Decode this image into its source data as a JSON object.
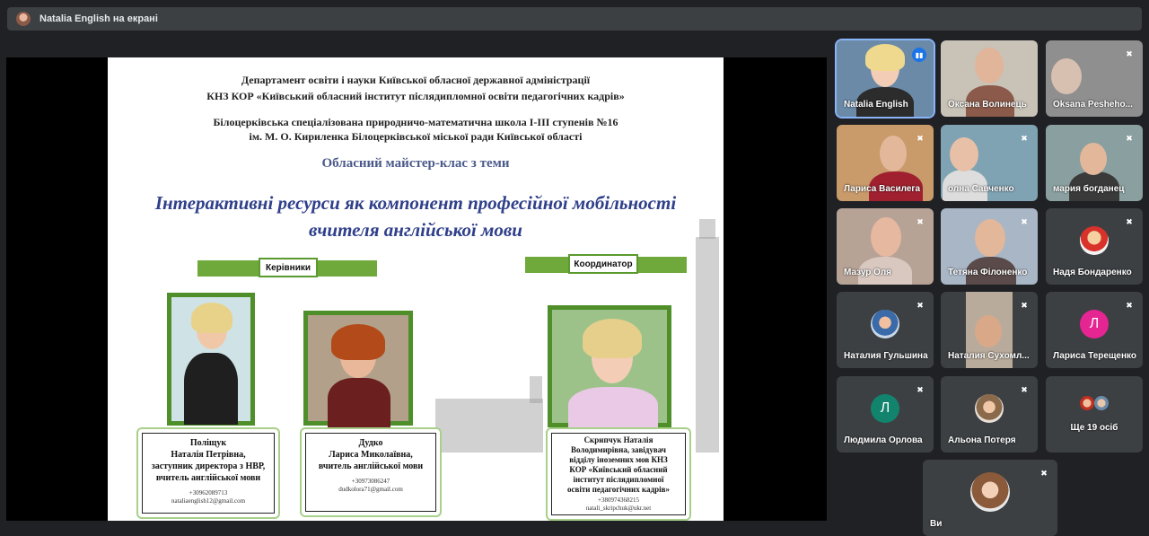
{
  "presenter": {
    "text": "Natalia English на екрані"
  },
  "slide": {
    "header1": "Департамент освіти і науки Київської обласної державної адміністрації",
    "header2": "КНЗ КОР «Київський обласний інститут післядипломної освіти педагогічних кадрів»",
    "header3": "Білоцерківська спеціалізована природничо-математична школа I-III ступенів №16",
    "header4": "ім. М. О. Кириленка Білоцерківської міської ради Київської області",
    "subtitle": "Обласний майстер-клас з теми",
    "topic1": "Інтерактивні ресурси як компонент професійної мобільності",
    "topic2": "вчителя англійської мови",
    "ribbon_left": "Керівники",
    "ribbon_right": "Координатор",
    "cards": [
      {
        "name": "Поліщук\nНаталія Петрівна,\nзаступник директора з НВР,\nвчитель англійської мови",
        "contact": "+30962089713\nnataliaenglish12@gmail.com"
      },
      {
        "name": "Дудко\nЛариса Миколаївна,\nвчитель англійської мови",
        "contact": "+30973086247\ndudkolora71@gmail.com"
      },
      {
        "name": "Скрипчук Наталія\nВолодимирівна, завідувач\nвідділу іноземних мов КНЗ\nКОР «Київський обласний\nінститут післядипломної\nосвіти педагогічних кадрів»",
        "contact": "+380974368215\nnatali_skripchuk@ukr.net"
      }
    ]
  },
  "participants": [
    {
      "name": "Natalia English",
      "mic": "speaking"
    },
    {
      "name": "Оксана Волинець",
      "mic": "none"
    },
    {
      "name": "Oksana Pesheho...",
      "mic": "muted"
    },
    {
      "name": "Лариса Василега",
      "mic": "muted"
    },
    {
      "name": "олна Савченко",
      "mic": "muted"
    },
    {
      "name": "мария богданец",
      "mic": "muted"
    },
    {
      "name": "Мазур Оля",
      "mic": "muted"
    },
    {
      "name": "Тетяна Філоненко",
      "mic": "muted"
    },
    {
      "name": "Надя Бондаренко",
      "mic": "muted"
    },
    {
      "name": "Наталия Гульшина",
      "mic": "muted"
    },
    {
      "name": "Наталия Сухомл...",
      "mic": "muted"
    },
    {
      "name": "Лариса Терещенко",
      "mic": "muted",
      "initial": "Л"
    },
    {
      "name": "Людмила Орлова",
      "mic": "muted",
      "initial": "Л"
    },
    {
      "name": "Альона Потеря",
      "mic": "muted"
    },
    {
      "name": "Ще 19 осіб",
      "mic": "none"
    },
    {
      "name": "Ви",
      "mic": "muted"
    }
  ],
  "colors": {
    "speaking": "#1a73e8",
    "tile": "#3c4043",
    "bg": "#202124",
    "avatar_pink": "#e52592",
    "avatar_teal": "#12846e",
    "ribbon": "#6fa83b"
  },
  "icons": {
    "mic_muted": "mic-off-icon",
    "speaking": "audio-wave-icon"
  }
}
